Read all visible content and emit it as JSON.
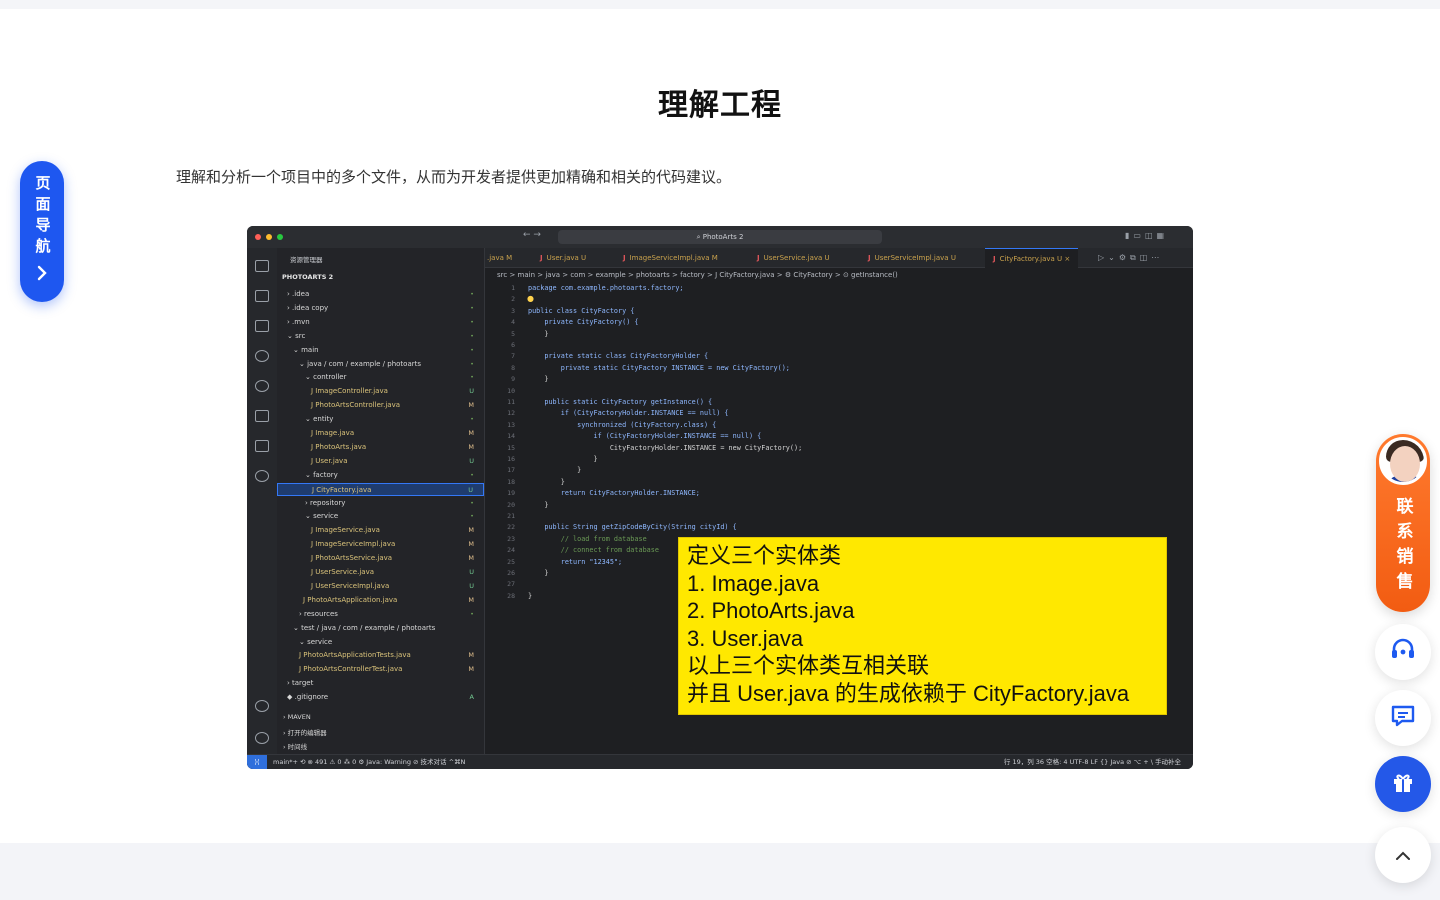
{
  "section": {
    "title": "理解工程",
    "description": "理解和分析一个项目中的多个文件，从而为开发者提供更加精确和相关的代码建议。"
  },
  "page_nav": {
    "label": "页面导航",
    "chevron": "›"
  },
  "contact_sales": {
    "label": "联系销售"
  },
  "float_buttons": {
    "support_icon": "headset-icon",
    "chat_icon": "chat-icon",
    "gift_icon": "gift-icon",
    "top_icon": "chevron-up-icon"
  },
  "ide": {
    "window_title": "PhotoArts 2",
    "sidebar_header": "资源管理器",
    "project_name": "PHOTOARTS 2",
    "tree": [
      {
        "label": "› .idea",
        "ind": "•"
      },
      {
        "label": "› .idea copy",
        "ind": "•"
      },
      {
        "label": "› .mvn",
        "ind": "•"
      },
      {
        "label": "⌄ src",
        "ind": "•"
      },
      {
        "label": "⌄ main",
        "ind": "•"
      },
      {
        "label": "⌄ java / com / example / photoarts",
        "ind": "•"
      },
      {
        "label": "⌄ controller",
        "ind": "•"
      },
      {
        "label": "J  ImageController.java",
        "ind": "U"
      },
      {
        "label": "J  PhotoArtsController.java",
        "ind": "M"
      },
      {
        "label": "⌄ entity",
        "ind": "•"
      },
      {
        "label": "J  Image.java",
        "ind": "M"
      },
      {
        "label": "J  PhotoArts.java",
        "ind": "M"
      },
      {
        "label": "J  User.java",
        "ind": "U"
      },
      {
        "label": "⌄ factory",
        "ind": "•"
      },
      {
        "label": "J  CityFactory.java",
        "ind": "U"
      },
      {
        "label": "› repository",
        "ind": "•"
      },
      {
        "label": "⌄ service",
        "ind": "•"
      },
      {
        "label": "J  ImageService.java",
        "ind": "M"
      },
      {
        "label": "J  ImageServiceImpl.java",
        "ind": "M"
      },
      {
        "label": "J  PhotoArtsService.java",
        "ind": "M"
      },
      {
        "label": "J  UserService.java",
        "ind": "U"
      },
      {
        "label": "J  UserServiceImpl.java",
        "ind": "U"
      },
      {
        "label": "J  PhotoArtsApplication.java",
        "ind": "M"
      },
      {
        "label": "› resources",
        "ind": "•"
      },
      {
        "label": "⌄ test / java / com / example / photoarts",
        "ind": ""
      },
      {
        "label": "⌄ service",
        "ind": ""
      },
      {
        "label": "J  PhotoArtsApplicationTests.java",
        "ind": "M"
      },
      {
        "label": "J  PhotoArtsControllerTest.java",
        "ind": "M"
      },
      {
        "label": "› target",
        "ind": ""
      },
      {
        "label": "◆ .gitignore",
        "ind": "A"
      }
    ],
    "sidebar_sections": [
      "› MAVEN",
      "› 打开的编辑器",
      "› 时间线"
    ],
    "tabs": [
      {
        "label": ".java M",
        "active": false
      },
      {
        "label": "User.java U",
        "active": false
      },
      {
        "label": "ImageServiceImpl.java M",
        "active": false
      },
      {
        "label": "UserService.java U",
        "active": false
      },
      {
        "label": "UserServiceImpl.java U",
        "active": false
      },
      {
        "label": "CityFactory.java U ×",
        "active": true
      }
    ],
    "breadcrumb": "src > main > java > com > example > photoarts > factory > J CityFactory.java > ⚙ CityFactory > ⊙ getInstance()",
    "code_lines": [
      "package com.example.photoarts.factory;",
      "",
      "public class CityFactory {",
      "    private CityFactory() {",
      "    }",
      "",
      "    private static class CityFactoryHolder {",
      "        private static CityFactory INSTANCE = new CityFactory();",
      "    }",
      "",
      "    public static CityFactory getInstance() {",
      "        if (CityFactoryHolder.INSTANCE == null) {",
      "            synchronized (CityFactory.class) {",
      "                if (CityFactoryHolder.INSTANCE == null) {",
      "                    CityFactoryHolder.INSTANCE = new CityFactory();",
      "                }",
      "            }",
      "        }",
      "        return CityFactoryHolder.INSTANCE;",
      "    }",
      "",
      "    public String getZipCodeByCity(String cityId) {",
      "        // load from database",
      "        // connect from database",
      "        return \"12345\";",
      "    }",
      "",
      "}"
    ],
    "status_left": "main*+ ⟲   ⊗ 491 ⚠ 0   ⁂ 0   ⚙ Java: Warning   ⊘ 技术对话 ^⌘N",
    "status_right": "行 19，列 36    空格: 4    UTF-8    LF    {} Java    ⊘ ⌥ + \\ 手动补全",
    "callout_lines": [
      "定义三个实体类",
      "1. Image.java",
      "2. PhotoArts.java",
      "3. User.java",
      "以上三个实体类互相关联",
      "并且 User.java  的生成依赖于 CityFactory.java"
    ]
  }
}
